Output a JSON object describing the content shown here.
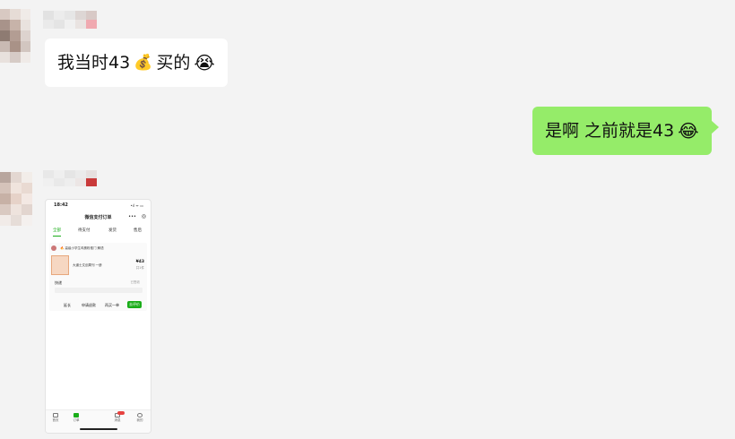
{
  "chat": {
    "messages": [
      {
        "side": "incoming",
        "text": "我当时43",
        "emoji1": "💰",
        "text2": "买的",
        "emoji2": "😭"
      },
      {
        "side": "outgoing",
        "text": "是啊 之前就是43",
        "emoji": "😂"
      }
    ]
  },
  "shared_screenshot": {
    "time": "18:42",
    "signal": "•ıl ᯤ ▭",
    "title": "微信支付订单",
    "tabs": [
      "全部",
      "待支付",
      "发货",
      "售后"
    ],
    "shop_tag": "🔥 高级小学生鸡蛋粉推门  解语",
    "product_name": "大道士文创周刊 一册",
    "price": "¥43",
    "qty": "共1件",
    "logistics_label": "快递",
    "logistics_note": "已签收",
    "actions": [
      "延长",
      "申请退款",
      "再买一单",
      "去评价"
    ],
    "footer": [
      "首页",
      "订单",
      "消息",
      "我的"
    ]
  },
  "colors": {
    "background": "#f3f3f3",
    "incoming_bubble": "#ffffff",
    "outgoing_bubble": "#95ec69",
    "accent_green": "#1aad19"
  }
}
